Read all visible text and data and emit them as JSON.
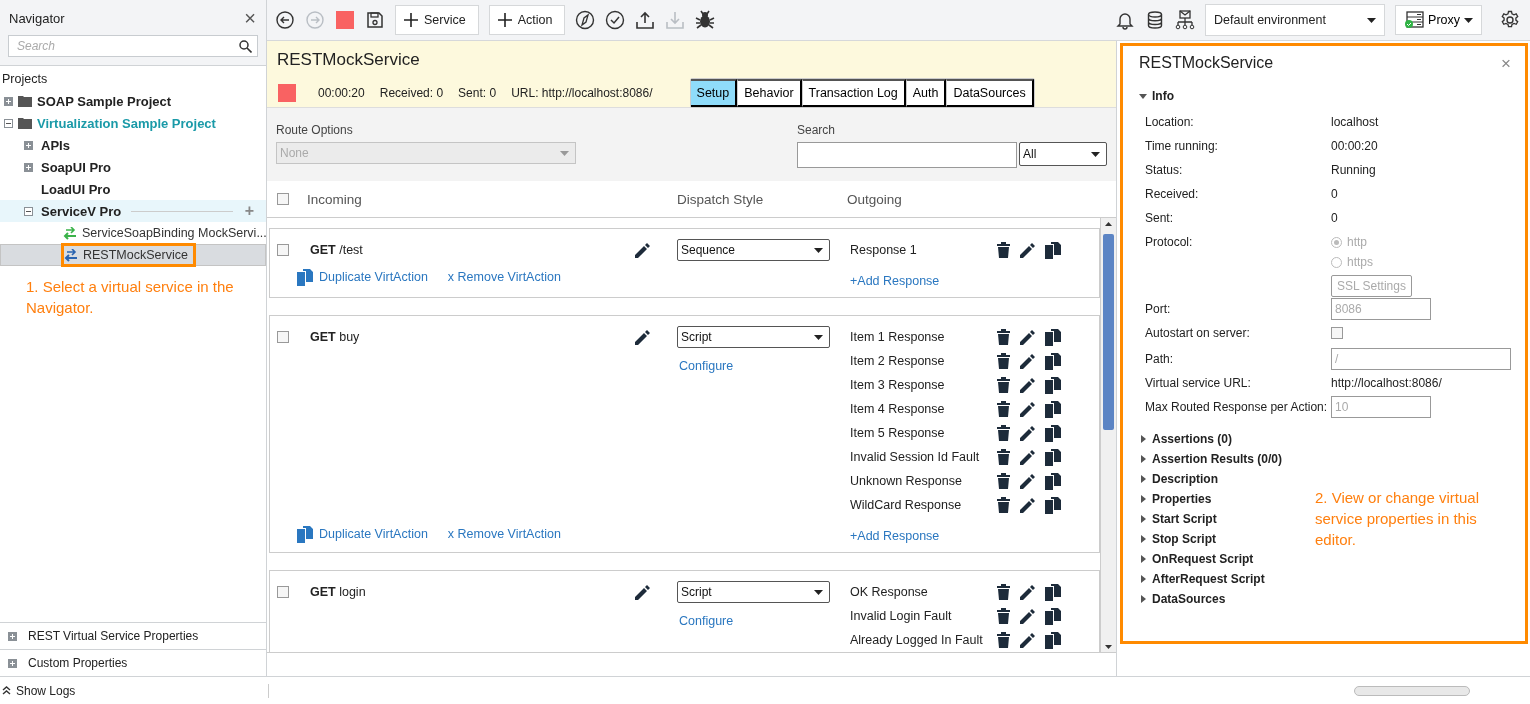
{
  "navigator": {
    "title": "Navigator",
    "close": "×",
    "search": {
      "placeholder": "Search"
    },
    "section": "Projects",
    "tree": [
      {
        "label": "SOAP Sample Project",
        "kind": "project",
        "expanded": false,
        "active": false,
        "highlighted": false,
        "selected": false,
        "outlined": false
      },
      {
        "label": "Virtualization Sample Project",
        "kind": "project",
        "expanded": true,
        "active": true,
        "highlighted": false,
        "selected": false,
        "outlined": false,
        "children": [
          {
            "label": "APIs",
            "kind": "group",
            "expanded": false,
            "active": false,
            "highlighted": false,
            "selected": false,
            "outlined": false
          },
          {
            "label": "SoapUI Pro",
            "kind": "group",
            "expanded": false,
            "active": false,
            "highlighted": false,
            "selected": false,
            "outlined": false
          },
          {
            "label": "LoadUI Pro",
            "kind": "leaf",
            "active": false,
            "highlighted": false,
            "selected": false,
            "outlined": false
          },
          {
            "label": "ServiceV Pro",
            "kind": "group",
            "expanded": true,
            "active": false,
            "highlighted": true,
            "selected": false,
            "outlined": false,
            "add": "+",
            "children": [
              {
                "label": "ServiceSoapBinding MockServi...",
                "kind": "soap",
                "active": false,
                "highlighted": false,
                "selected": false,
                "outlined": false
              },
              {
                "label": "RESTMockService",
                "kind": "rest",
                "active": false,
                "highlighted": false,
                "selected": true,
                "outlined": true
              }
            ]
          }
        ]
      }
    ],
    "callout": "1. Select a virtual service in the Navigator.",
    "panels": [
      {
        "label": "REST Virtual Service Properties",
        "expanded": false
      },
      {
        "label": "Custom Properties",
        "expanded": false
      }
    ]
  },
  "toolbar": {
    "left": [
      {
        "kind": "back",
        "disabled": false
      },
      {
        "kind": "forward",
        "disabled": true
      },
      {
        "kind": "stop",
        "disabled": false
      },
      {
        "kind": "save",
        "disabled": false
      }
    ],
    "buttons": [
      {
        "label": "Service"
      },
      {
        "label": "Action"
      }
    ],
    "tools": [
      {
        "kind": "compass",
        "disabled": false
      },
      {
        "kind": "check",
        "disabled": false
      },
      {
        "kind": "upload",
        "disabled": false
      },
      {
        "kind": "download",
        "disabled": true
      },
      {
        "kind": "bug",
        "disabled": false
      }
    ],
    "right": [
      {
        "kind": "bell",
        "disabled": false
      },
      {
        "kind": "database",
        "disabled": false
      },
      {
        "kind": "network",
        "disabled": false
      }
    ],
    "environment": "Default environment",
    "proxy": "Proxy"
  },
  "service": {
    "name": "RESTMockService",
    "time": "00:00:20",
    "received": "Received: 0",
    "sent": "Sent: 0",
    "url": "URL: http://localhost:8086/",
    "tabs": [
      {
        "label": "Setup",
        "selected": true
      },
      {
        "label": "Behavior",
        "selected": false
      },
      {
        "label": "Transaction Log",
        "selected": false
      },
      {
        "label": "Auth",
        "selected": false
      },
      {
        "label": "DataSources",
        "selected": false
      }
    ],
    "route_options": {
      "label": "Route Options",
      "value": "None",
      "disabled": true
    },
    "search": {
      "label": "Search",
      "filter": "All"
    },
    "select_all_checked": false,
    "columns": [
      "Incoming",
      "Dispatch Style",
      "Outgoing"
    ],
    "actions": [
      {
        "method": "GET",
        "path": "/test",
        "checked": false,
        "dispatch": "Sequence",
        "responses": [
          "Response 1"
        ],
        "add_response": "+Add Response",
        "duplicate": "Duplicate VirtAction",
        "remove": "x Remove VirtAction"
      },
      {
        "method": "GET",
        "path": "buy",
        "checked": false,
        "dispatch": "Script",
        "configure": "Configure",
        "responses": [
          "Item 1 Response",
          "Item 2 Response",
          "Item 3 Response",
          "Item 4 Response",
          "Item 5 Response",
          "Invalid Session Id Fault",
          "Unknown Response",
          "WildCard Response"
        ],
        "add_response": "+Add Response",
        "duplicate": "Duplicate VirtAction",
        "remove": "x Remove VirtAction"
      },
      {
        "method": "GET",
        "path": "login",
        "checked": false,
        "dispatch": "Script",
        "configure": "Configure",
        "responses": [
          "OK Response",
          "Invalid Login Fault",
          "Already Logged In Fault"
        ]
      }
    ]
  },
  "properties": {
    "title": "RESTMockService",
    "close": "×",
    "outlined": true,
    "info": {
      "label": "Info",
      "expanded": true,
      "fields": [
        {
          "kind": "text",
          "label": "Location:",
          "value": "localhost"
        },
        {
          "kind": "text",
          "label": "Time running:",
          "value": "00:00:20"
        },
        {
          "kind": "text",
          "label": "Status:",
          "value": "Running"
        },
        {
          "kind": "text",
          "label": "Received:",
          "value": "0"
        },
        {
          "kind": "text",
          "label": "Sent:",
          "value": "0"
        },
        {
          "kind": "radio",
          "label": "Protocol:",
          "disabled": true,
          "options": [
            {
              "label": "http",
              "selected": true
            },
            {
              "label": "https",
              "selected": false
            }
          ],
          "button": "SSL Settings"
        },
        {
          "kind": "input",
          "label": "Port:",
          "value": "8086",
          "disabled": true
        },
        {
          "kind": "checkbox",
          "label": "Autostart on server:",
          "checked": false
        },
        {
          "kind": "wide_input",
          "label": "Path:",
          "value": "/",
          "disabled": true
        },
        {
          "kind": "text",
          "label": "Virtual service URL:",
          "value": "http://localhost:8086/"
        },
        {
          "kind": "input",
          "label": "Max Routed Response per Action:",
          "value": "10",
          "disabled": true
        }
      ]
    },
    "sections": [
      {
        "label": "Assertions (0)",
        "expanded": false
      },
      {
        "label": "Assertion Results (0/0)",
        "expanded": false
      },
      {
        "label": "Description",
        "expanded": false
      },
      {
        "label": "Properties",
        "expanded": false
      },
      {
        "label": "Start Script",
        "expanded": false
      },
      {
        "label": "Stop Script",
        "expanded": false
      },
      {
        "label": "OnRequest Script",
        "expanded": false
      },
      {
        "label": "AfterRequest Script",
        "expanded": false
      },
      {
        "label": "DataSources",
        "expanded": false
      }
    ],
    "callout": "2. View or change virtual service properties in this editor."
  },
  "status_bar": {
    "show_logs": "Show Logs"
  }
}
